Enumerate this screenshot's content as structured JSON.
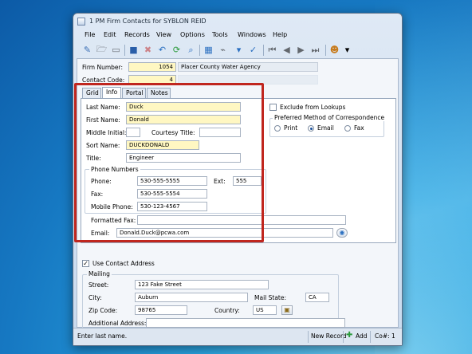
{
  "window": {
    "title": "1 PM Firm Contacts for SYBLON REID"
  },
  "menu": [
    "File",
    "Edit",
    "Records",
    "View",
    "Options",
    "Tools",
    "Windows",
    "Help"
  ],
  "header": {
    "firm_number_label": "Firm Number:",
    "firm_number": "1054",
    "firm_name": "Placer County Water Agency",
    "contact_code_label": "Contact Code:",
    "contact_code": "4"
  },
  "tabs": [
    "Grid",
    "Info",
    "Portal",
    "Notes"
  ],
  "info": {
    "last_name_label": "Last Name:",
    "last_name": "Duck",
    "first_name_label": "First Name:",
    "first_name": "Donald",
    "middle_initial_label": "Middle Initial:",
    "middle_initial": "",
    "courtesy_title_label": "Courtesy Title:",
    "courtesy_title": "",
    "sort_name_label": "Sort Name:",
    "sort_name": "DUCKDONALD",
    "title_label": "Title:",
    "title": "Engineer",
    "phone_group_label": "Phone Numbers",
    "phone_label": "Phone:",
    "phone": "530-555-5555",
    "ext_label": "Ext:",
    "ext": "555",
    "fax_label": "Fax:",
    "fax": "530-555-5554",
    "mobile_label": "Mobile Phone:",
    "mobile": "530-123-4567",
    "formatted_fax_label": "Formatted Fax:",
    "formatted_fax": "",
    "email_label": "Email:",
    "email": "Donald.Duck@pcwa.com",
    "exclude_label": "Exclude from Lookups",
    "pref_group_label": "Preferred Method of Correspondence",
    "pref_options": [
      "Print",
      "Email",
      "Fax"
    ],
    "pref_selected": "Email"
  },
  "address": {
    "use_contact_label": "Use Contact Address",
    "use_contact_checked": true,
    "mailing_label": "Mailing",
    "street_label": "Street:",
    "street": "123 Fake Street",
    "city_label": "City:",
    "city": "Auburn",
    "state_label": "Mail State:",
    "state": "CA",
    "zip_label": "Zip Code:",
    "zip": "98765",
    "country_label": "Country:",
    "country": "US",
    "additional_label": "Additional Address:",
    "additional": ""
  },
  "status": {
    "message": "Enter last name.",
    "new_record": "New Record",
    "add": "Add",
    "count": "Co#: 1"
  },
  "colors": {
    "highlight": "#c0261e",
    "required_field": "#fff7c2"
  }
}
